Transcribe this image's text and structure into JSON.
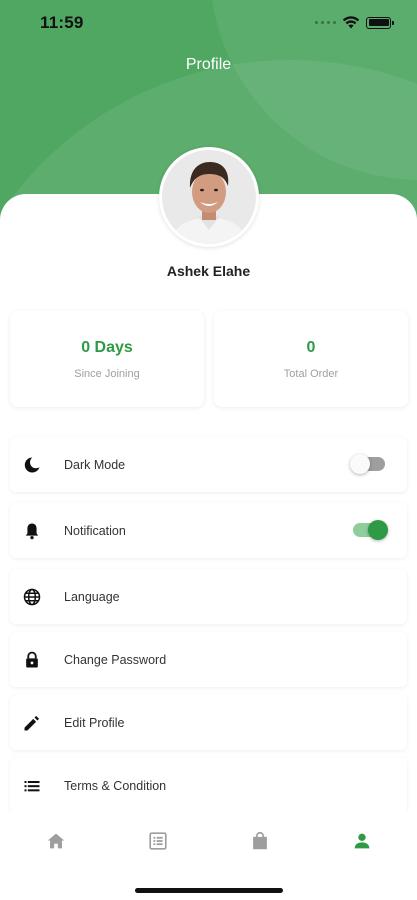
{
  "status_bar": {
    "time": "11:59"
  },
  "header": {
    "title": "Profile"
  },
  "profile": {
    "name": "Ashek Elahe"
  },
  "stats": [
    {
      "value": "0 Days",
      "label": "Since Joining"
    },
    {
      "value": "0",
      "label": "Total Order"
    }
  ],
  "menu": {
    "dark_mode": {
      "label": "Dark Mode",
      "icon": "moon-icon",
      "enabled": false
    },
    "notification": {
      "label": "Notification",
      "icon": "bell-icon",
      "enabled": true
    },
    "language": {
      "label": "Language",
      "icon": "globe-icon"
    },
    "change_password": {
      "label": "Change Password",
      "icon": "lock-icon"
    },
    "edit_profile": {
      "label": "Edit Profile",
      "icon": "pencil-icon"
    },
    "terms": {
      "label": "Terms & Condition",
      "icon": "list-icon"
    }
  },
  "bottom_nav": [
    {
      "name": "home-icon",
      "active": false
    },
    {
      "name": "orders-icon",
      "active": false
    },
    {
      "name": "cart-bag-icon",
      "active": false
    },
    {
      "name": "profile-icon",
      "active": true
    }
  ],
  "colors": {
    "brand_green": "#4fa762",
    "accent_green": "#2e9a45",
    "toggle_on_track": "#8fcd9c",
    "toggle_off_track": "#9e9e9e",
    "inactive_icon": "#9e9e9e"
  }
}
